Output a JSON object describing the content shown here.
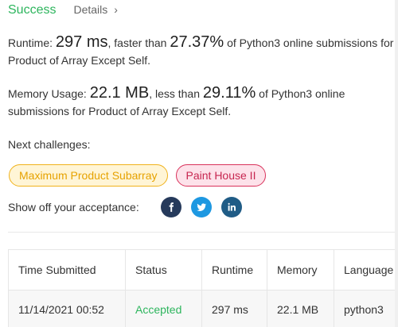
{
  "header": {
    "status": "Success",
    "details_label": "Details",
    "details_chevron": "›"
  },
  "runtime": {
    "label": "Runtime:",
    "value": "297 ms",
    "comparison": ", faster than",
    "percent": "27.37%",
    "suffix": "of Python3 online submissions for Product of Array Except Self."
  },
  "memory": {
    "label": "Memory Usage:",
    "value": "22.1 MB",
    "comparison": ", less than",
    "percent": "29.11%",
    "suffix": "of Python3 online submissions for Product of Array Except Self."
  },
  "next": {
    "label": "Next challenges:",
    "items": [
      {
        "label": "Maximum Product Subarray",
        "difficulty": "medium",
        "color": "#f0b21c"
      },
      {
        "label": "Paint House II",
        "difficulty": "hard",
        "color": "#d9325b"
      }
    ]
  },
  "share": {
    "label": "Show off your acceptance:",
    "icons": [
      "facebook-icon",
      "twitter-icon",
      "linkedin-icon"
    ]
  },
  "table": {
    "columns": [
      "Time Submitted",
      "Status",
      "Runtime",
      "Memory",
      "Language"
    ],
    "rows": [
      {
        "time": "11/14/2021 00:52",
        "status": "Accepted",
        "runtime": "297 ms",
        "memory": "22.1 MB",
        "language": "python3"
      }
    ]
  },
  "colors": {
    "accent_green": "#2db55d",
    "medium": "#f0b21c",
    "hard": "#d9325b"
  }
}
